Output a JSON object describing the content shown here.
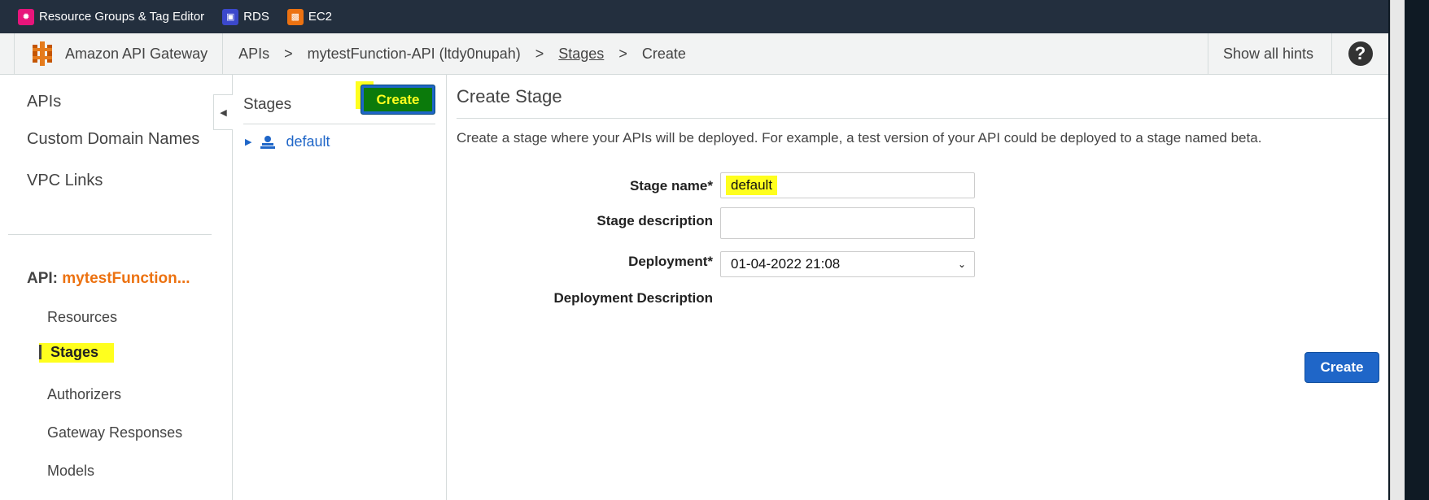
{
  "favorites": [
    {
      "label": "Resource Groups & Tag Editor",
      "icon": "resource-groups-icon"
    },
    {
      "label": "RDS",
      "icon": "rds-icon"
    },
    {
      "label": "EC2",
      "icon": "ec2-icon"
    }
  ],
  "header": {
    "service_name": "Amazon API Gateway",
    "breadcrumb": {
      "apis": "APIs",
      "sep1": ">",
      "api": "mytestFunction-API (ltdy0nupah)",
      "sep2": ">",
      "stages": "Stages",
      "sep3": ">",
      "current": "Create"
    },
    "hints": "Show all hints",
    "help": "?"
  },
  "sidebar": {
    "top_items": [
      "APIs",
      "Custom Domain Names",
      "VPC Links"
    ],
    "api_prefix": "API:",
    "api_name": "mytestFunction...",
    "sub_items": [
      "Resources",
      "Stages",
      "Authorizers",
      "Gateway Responses",
      "Models"
    ]
  },
  "stages_panel": {
    "title": "Stages",
    "create_label": "Create",
    "items": [
      "default"
    ]
  },
  "main": {
    "title": "Create Stage",
    "description": "Create a stage where your APIs will be deployed. For example, a test version of your API could be deployed to a stage named beta.",
    "fields": {
      "stage_name_label": "Stage name*",
      "stage_name_value": "default",
      "stage_description_label": "Stage description",
      "stage_description_value": "",
      "deployment_label": "Deployment*",
      "deployment_value": "01-04-2022 21:08",
      "deployment_description_label": "Deployment Description"
    },
    "create_label": "Create"
  },
  "colors": {
    "accent_orange": "#ec7211",
    "link_blue": "#1f66c8",
    "highlight_yellow": "#ffff1e",
    "nav_dark": "#232f3e"
  }
}
